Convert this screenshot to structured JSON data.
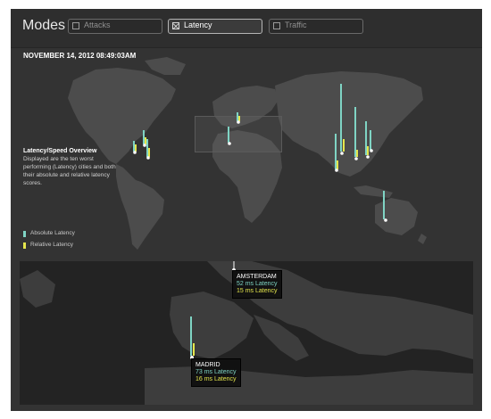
{
  "header": {
    "title": "Modes",
    "tabs": [
      {
        "label": "Attacks",
        "active": false
      },
      {
        "label": "Latency",
        "active": true
      },
      {
        "label": "Traffic",
        "active": false
      }
    ]
  },
  "timestamp": "NOVEMBER 14, 2012 08:49:03AM",
  "info": {
    "title": "Latency/Speed Overview",
    "text": "Displayed are the ten worst performing (Latency) cities and both their absolute and relative latency scores."
  },
  "legend": [
    {
      "label": "Absolute Latency",
      "color": "#7fd4c4"
    },
    {
      "label": "Relative Latency",
      "color": "#e4e64c"
    }
  ],
  "colors": {
    "absolute": "#7fd4c4",
    "relative": "#e4e64c",
    "land": "#4c4c4c",
    "water": "#333333"
  },
  "detail_view": {
    "cities": [
      {
        "name": "AMSTERDAM",
        "absolute_label": "52 ms Latency",
        "relative_label": "15 ms Latency"
      },
      {
        "name": "MADRID",
        "absolute_label": "73 ms Latency",
        "relative_label": "16 ms Latency"
      }
    ]
  }
}
